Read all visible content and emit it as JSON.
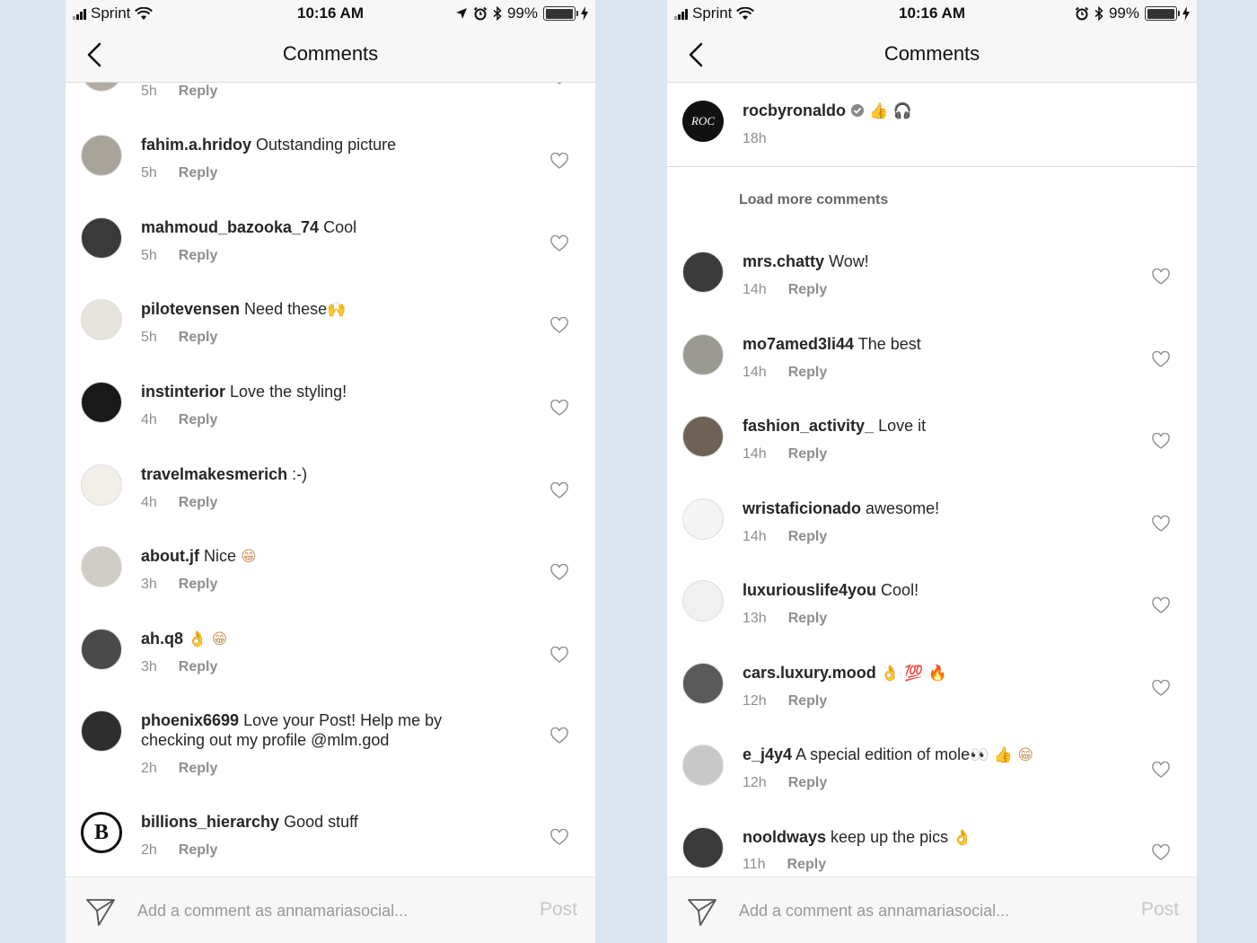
{
  "status_bar": {
    "carrier": "Sprint",
    "time": "10:16 AM",
    "battery": "99%",
    "battery_level": 0.99
  },
  "nav": {
    "title": "Comments"
  },
  "left_screen": {
    "partial_top": {
      "time": "5h",
      "reply": "Reply"
    },
    "comments": [
      {
        "username": "fahim.a.hridoy",
        "text": "Outstanding picture",
        "time": "5h",
        "reply": "Reply",
        "avatar_color": "#a8a49a"
      },
      {
        "username": "mahmoud_bazooka_74",
        "text": "Cool",
        "time": "5h",
        "reply": "Reply",
        "avatar_color": "#3a3a3a"
      },
      {
        "username": "pilotevensen",
        "text": "Need these",
        "emoji": "🙌",
        "time": "5h",
        "reply": "Reply",
        "avatar_color": "#e6e2dc"
      },
      {
        "username": "instinterior",
        "text": "Love the styling!",
        "time": "4h",
        "reply": "Reply",
        "avatar_color": "#1a1a1a"
      },
      {
        "username": "travelmakesmerich",
        "text": ":-)",
        "time": "4h",
        "reply": "Reply",
        "avatar_color": "#f2efe9"
      },
      {
        "username": "about.jf",
        "text": "Nice",
        "emoji": "😁",
        "time": "3h",
        "reply": "Reply",
        "avatar_color": "#d0ccc6"
      },
      {
        "username": "ah.q8",
        "text": "",
        "emoji": "👌 😁",
        "time": "3h",
        "reply": "Reply",
        "avatar_color": "#4a4a4a"
      },
      {
        "username": "phoenix6699",
        "text": "Love your Post! Help me by checking out my profile @mlm.god",
        "time": "2h",
        "reply": "Reply",
        "avatar_color": "#2e2e2e"
      },
      {
        "username": "billions_hierarchy",
        "text": "Good stuff",
        "time": "2h",
        "reply": "Reply",
        "avatar_color": "#ffffff",
        "avatar_letter": "B"
      }
    ],
    "input_placeholder": "Add a comment as annamariasocial...",
    "post_label": "Post"
  },
  "right_screen": {
    "caption": {
      "username": "rocbyronaldo",
      "emoji": "👍 🎧",
      "time": "18h",
      "avatar_text": "ROC"
    },
    "load_more": "Load more comments",
    "comments": [
      {
        "username": "mrs.chatty",
        "text": "Wow!",
        "time": "14h",
        "reply": "Reply",
        "avatar_color": "#3b3b3b"
      },
      {
        "username": "mo7amed3li44",
        "text": "The best",
        "time": "14h",
        "reply": "Reply",
        "avatar_color": "#9a9a92"
      },
      {
        "username": "fashion_activity_",
        "text": "Love it",
        "time": "14h",
        "reply": "Reply",
        "avatar_color": "#6e6256"
      },
      {
        "username": "wristaficionado",
        "text": "awesome!",
        "time": "14h",
        "reply": "Reply",
        "avatar_color": "#f4f4f4"
      },
      {
        "username": "luxuriouslife4you",
        "text": "Cool!",
        "time": "13h",
        "reply": "Reply",
        "avatar_color": "#f0f0f0"
      },
      {
        "username": "cars.luxury.mood",
        "text": "",
        "emoji": "👌 💯 🔥",
        "time": "12h",
        "reply": "Reply",
        "avatar_color": "#5a5a5a"
      },
      {
        "username": "e_j4y4",
        "text": "A special edition of mole",
        "emoji": "👀 👍 😁",
        "time": "12h",
        "reply": "Reply",
        "avatar_color": "#c8c8c8"
      },
      {
        "username": "nooldways",
        "text": "keep up the pics",
        "emoji": "👌",
        "time": "11h",
        "reply": "Reply",
        "avatar_color": "#3a3a3a"
      }
    ],
    "input_placeholder": "Add a comment as annamariasocial...",
    "post_label": "Post"
  }
}
